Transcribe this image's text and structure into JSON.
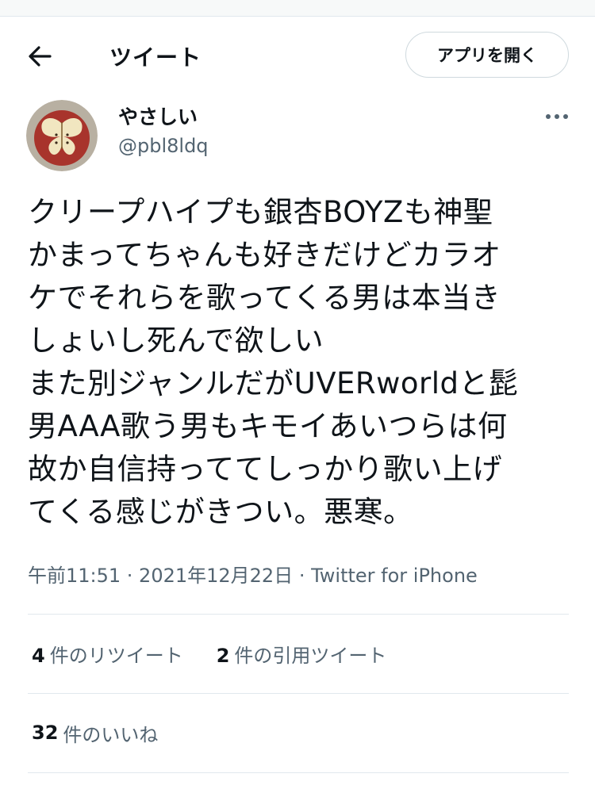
{
  "header": {
    "back_icon": "arrow-left-icon",
    "title": "ツイート",
    "open_app_label": "アプリを開く"
  },
  "tweet": {
    "author": {
      "display_name": "やさしい",
      "handle": "@pbl8ldq",
      "avatar_icon": "apple-butterfly-avatar"
    },
    "more_icon": "more-dots-icon",
    "text": "クリープハイプも銀杏BOYZも神聖\nかまってちゃんも好きだけどカラオ\nケでそれらを歌ってくる男は本当き\nしょいし死んで欲しい\nまた別ジャンルだがUVERworldと髭\n男AAA歌う男もキモイあいつらは何\n故か自信持っててしっかり歌い上げ\nてくる感じがきつい。悪寒。",
    "meta": "午前11:51 · 2021年12月22日 · Twitter for iPhone"
  },
  "stats": {
    "retweets_count": "4",
    "retweets_label": "件のリツイート",
    "quotes_count": "2",
    "quotes_label": "件の引用ツイート",
    "likes_count": "32",
    "likes_label": "件のいいね"
  },
  "colors": {
    "text_primary": "#0f1419",
    "text_secondary": "#536471",
    "divider": "#e1e8ed"
  }
}
